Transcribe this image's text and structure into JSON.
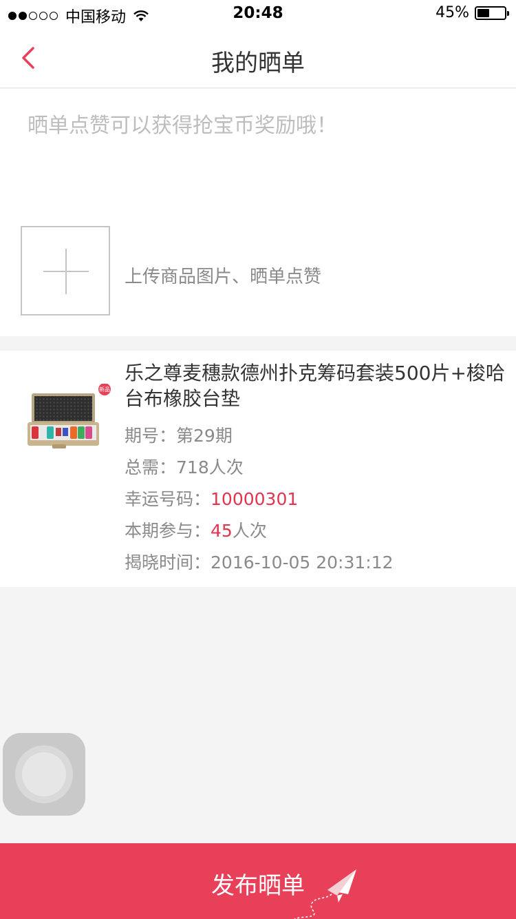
{
  "status_bar": {
    "carrier": "中国移动",
    "time": "20:48",
    "battery": "45%",
    "battery_level": 0.45
  },
  "nav": {
    "title": "我的晒单"
  },
  "compose": {
    "placeholder": "晒单点赞可以获得抢宝币奖励哦！",
    "upload_label": "上传商品图片、晒单点赞"
  },
  "product": {
    "badge": "新品",
    "title": "乐之尊麦穗款德州扑克筹码套装500片+梭哈台布橡胶台垫",
    "period_label": "期号：",
    "period_value": "第29期",
    "total_label": "总需：",
    "total_value": "718人次",
    "lucky_label": "幸运号码：",
    "lucky_value": "10000301",
    "join_label": "本期参与：",
    "join_count": "45",
    "join_unit": "人次",
    "time_label": "揭晓时间：",
    "time_value": "2016-10-05 20:31:12"
  },
  "publish": {
    "label": "发布晒单"
  },
  "colors": {
    "accent": "#e9405a",
    "highlight": "#e0344f"
  }
}
